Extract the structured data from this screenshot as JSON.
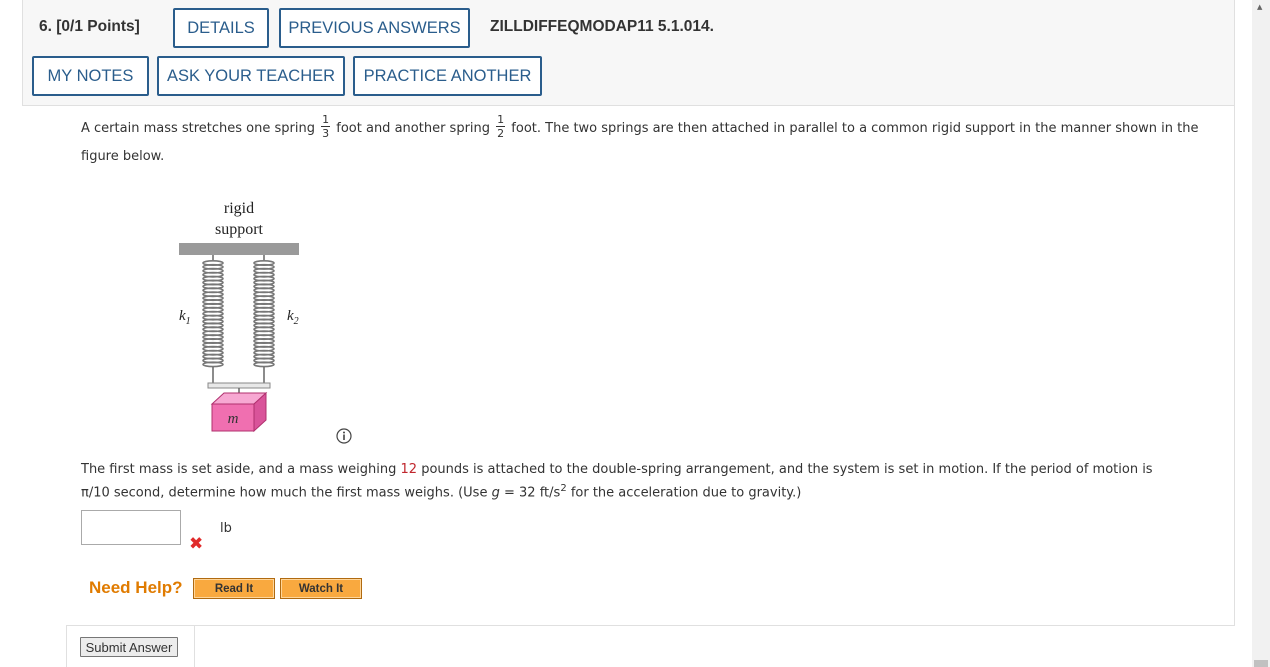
{
  "header": {
    "question_number": "6.",
    "points": "[0/1 Points]",
    "details_label": "DETAILS",
    "previous_answers_label": "PREVIOUS ANSWERS",
    "question_code": "ZILLDIFFEQMODAP11 5.1.014.",
    "my_notes_label": "MY NOTES",
    "ask_teacher_label": "ASK YOUR TEACHER",
    "practice_another_label": "PRACTICE ANOTHER"
  },
  "problem": {
    "line1_a": "A certain mass stretches one spring",
    "frac1_num": "1",
    "frac1_den": "3",
    "line1_b": "foot and another spring",
    "frac2_num": "1",
    "frac2_den": "2",
    "line1_c": "foot. The two springs are then attached in parallel to a common rigid support in the manner shown in the",
    "line2": "figure below.",
    "para2_a": "The first mass is set aside, and a mass weighing",
    "weight": "12",
    "para2_b": "pounds is attached to the double-spring arrangement, and the system is set in motion. If the period of motion is",
    "period": "π/10",
    "para2_c": "second, determine how much the first mass weighs. (Use",
    "g_var": "g",
    "g_eq": "= 32 ft/s",
    "g_exp": "2",
    "para2_d": "for the acceleration due to gravity.)"
  },
  "figure": {
    "support_line1": "rigid",
    "support_line2": "support",
    "k1_label": "k",
    "k1_sub": "1",
    "k2_label": "k",
    "k2_sub": "2",
    "mass_label": "m"
  },
  "answer": {
    "value": "",
    "unit": "lb",
    "status_icon": "x-mark-icon",
    "status_color": "#e02a2a"
  },
  "help": {
    "need_help_label": "Need Help?",
    "read_it_label": "Read It",
    "watch_it_label": "Watch It"
  },
  "submit_label": "Submit Answer",
  "colors": {
    "accent": "#2a5d8c",
    "help_orange": "#e07b00",
    "help_button": "#f9a93f",
    "highlight_red": "#c0262d",
    "mass_pink": "#f06fb0"
  }
}
